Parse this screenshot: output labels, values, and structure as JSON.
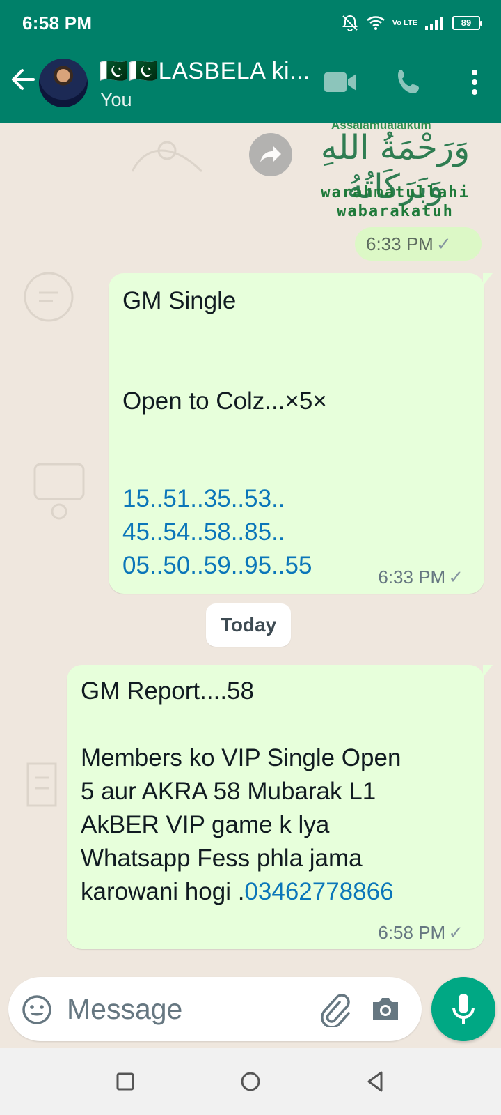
{
  "status_bar": {
    "time": "6:58 PM",
    "battery": "89",
    "network": "Vo LTE"
  },
  "header": {
    "title": "🇵🇰🇵🇰LASBELA ki...",
    "subtitle": "You",
    "icons": [
      "back-arrow-icon",
      "avatar",
      "video-call-icon",
      "voice-call-icon",
      "more-options-icon"
    ]
  },
  "messages": [
    {
      "type": "sticker",
      "sticker_text": {
        "top": "Assalamualaikum",
        "arabic": "وَرَحْمَةُ اللهِ وَبَرَكَاتُهُ",
        "line1": "warahmatullahi",
        "line2": "wabarakatuh"
      },
      "time": "6:33 PM"
    },
    {
      "type": "text",
      "line1": "GM Single",
      "line2": "Open to Colz...×5×",
      "numbers": [
        "15..51..35..53..",
        "45..54..58..85..",
        "05..50..59..95..55"
      ],
      "time": "6:33 PM"
    },
    {
      "type": "text",
      "title": "GM Report....58",
      "body": "Members ko VIP Single Open\n5 aur AKRA 58 Mubarak L1\nAkBER VIP game k lya\nWhatsapp Fess phla jama\nkarowani hogi .",
      "phone_link": "03462778866",
      "time": "6:58 PM"
    }
  ],
  "date_divider": "Today",
  "input_bar": {
    "placeholder": "Message",
    "icons": [
      "emoji-icon",
      "attach-icon",
      "camera-icon",
      "mic-icon"
    ]
  },
  "colors": {
    "header": "#008069",
    "outgoing_bubble": "#e7ffdb",
    "chat_bg": "#efe7de",
    "link": "#0b76b9",
    "mic": "#00a884"
  }
}
